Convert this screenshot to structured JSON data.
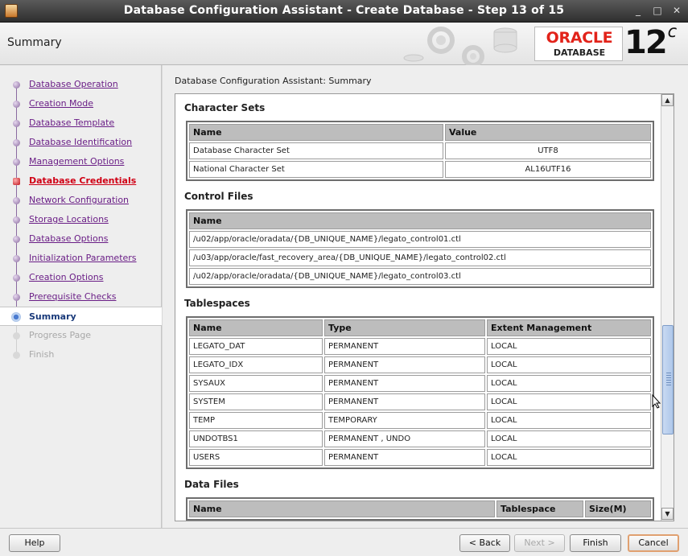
{
  "window": {
    "title": "Database Configuration Assistant - Create Database - Step 13 of 15",
    "controls": [
      "_",
      "□",
      "✕"
    ]
  },
  "header": {
    "page_title": "Summary",
    "brand": "ORACLE",
    "brand_sub": "DATABASE",
    "version": "12",
    "version_suffix": "c",
    "brand_color": "#e2231a"
  },
  "nav": {
    "items": [
      {
        "label": "Database Operation",
        "state": "done"
      },
      {
        "label": "Creation Mode",
        "state": "done"
      },
      {
        "label": "Database Template",
        "state": "done"
      },
      {
        "label": "Database Identification",
        "state": "done"
      },
      {
        "label": "Management Options",
        "state": "done"
      },
      {
        "label": "Database Credentials",
        "state": "error"
      },
      {
        "label": "Network Configuration",
        "state": "done"
      },
      {
        "label": "Storage Locations",
        "state": "done"
      },
      {
        "label": "Database Options",
        "state": "done"
      },
      {
        "label": "Initialization Parameters",
        "state": "done"
      },
      {
        "label": "Creation Options",
        "state": "done"
      },
      {
        "label": "Prerequisite Checks",
        "state": "done"
      },
      {
        "label": "Summary",
        "state": "current"
      },
      {
        "label": "Progress Page",
        "state": "disabled"
      },
      {
        "label": "Finish",
        "state": "disabled"
      }
    ]
  },
  "main": {
    "heading": "Database Configuration Assistant: Summary",
    "character_sets": {
      "title": "Character Sets",
      "headers": [
        "Name",
        "Value"
      ],
      "rows": [
        [
          "Database Character Set",
          "UTF8"
        ],
        [
          "National Character Set",
          "AL16UTF16"
        ]
      ]
    },
    "control_files": {
      "title": "Control Files",
      "headers": [
        "Name"
      ],
      "rows": [
        [
          "/u02/app/oracle/oradata/{DB_UNIQUE_NAME}/legato_control01.ctl"
        ],
        [
          "/u03/app/oracle/fast_recovery_area/{DB_UNIQUE_NAME}/legato_control02.ctl"
        ],
        [
          "/u02/app/oracle/oradata/{DB_UNIQUE_NAME}/legato_control03.ctl"
        ]
      ]
    },
    "tablespaces": {
      "title": "Tablespaces",
      "headers": [
        "Name",
        "Type",
        "Extent Management"
      ],
      "rows": [
        [
          "LEGATO_DAT",
          "PERMANENT",
          "LOCAL"
        ],
        [
          "LEGATO_IDX",
          "PERMANENT",
          "LOCAL"
        ],
        [
          "SYSAUX",
          "PERMANENT",
          "LOCAL"
        ],
        [
          "SYSTEM",
          "PERMANENT",
          "LOCAL"
        ],
        [
          "TEMP",
          "TEMPORARY",
          "LOCAL"
        ],
        [
          "UNDOTBS1",
          "PERMANENT , UNDO",
          "LOCAL"
        ],
        [
          "USERS",
          "PERMANENT",
          "LOCAL"
        ]
      ]
    },
    "data_files": {
      "title": "Data Files",
      "headers": [
        "Name",
        "Tablespace",
        "Size(M)"
      ]
    }
  },
  "buttons": {
    "help": "Help",
    "back": "< Back",
    "next": "Next >",
    "finish": "Finish",
    "cancel": "Cancel"
  }
}
